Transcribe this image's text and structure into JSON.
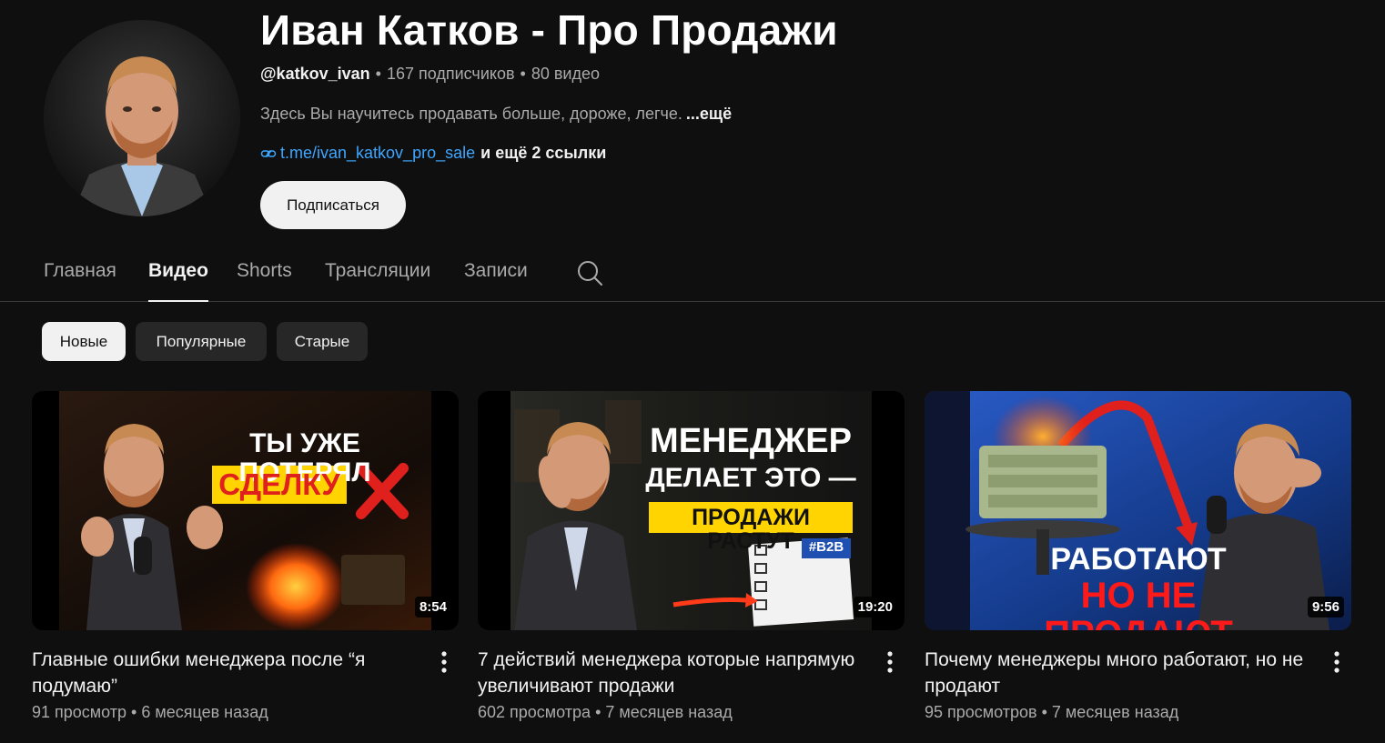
{
  "channel": {
    "name": "Иван Катков - Про Продажи",
    "handle": "@katkov_ivan",
    "subscribers": "167 подписчиков",
    "videos_count": "80 видео",
    "separator": "•",
    "description": "Здесь Вы научитесь продавать больше, дороже, легче.",
    "description_more": "...ещё",
    "link": "t.me/ivan_katkov_pro_sale",
    "more_links": "и ещё 2 ссылки",
    "subscribe_label": "Подписаться"
  },
  "tabs": [
    {
      "label": "Главная",
      "active": false
    },
    {
      "label": "Видео",
      "active": true
    },
    {
      "label": "Shorts",
      "active": false
    },
    {
      "label": "Трансляции",
      "active": false
    },
    {
      "label": "Записи",
      "active": false
    }
  ],
  "chips": [
    {
      "label": "Новые",
      "active": true
    },
    {
      "label": "Популярные",
      "active": false
    },
    {
      "label": "Старые",
      "active": false
    }
  ],
  "videos": [
    {
      "title": "Главные ошибки менеджера после “я подумаю”",
      "views": "91 просмотр",
      "age": "6 месяцев назад",
      "duration": "8:54",
      "thumb_line1": "ТЫ УЖЕ ПОТЕРЯЛ",
      "thumb_line2": "СДЕЛКУ"
    },
    {
      "title": "7 действий менеджера которые напрямую увеличивают продажи",
      "views": "602 просмотра",
      "age": "7 месяцев назад",
      "duration": "19:20",
      "thumb_line1": "МЕНЕДЖЕР",
      "thumb_line2": "ДЕЛАЕТ ЭТО —",
      "thumb_line3": "ПРОДАЖИ РАСТУТ",
      "thumb_tag": "#B2B"
    },
    {
      "title": "Почему менеджеры много работают, но не продают",
      "views": "95 просмотров",
      "age": "7 месяцев назад",
      "duration": "9:56",
      "thumb_line1": "РАБОТАЮТ",
      "thumb_line2": "НО НЕ ПРОДАЮТ"
    }
  ],
  "icons": {
    "link": "link-icon",
    "search": "search-icon",
    "more": "more-vert-icon"
  },
  "colors": {
    "background": "#0f0f0f",
    "link": "#3ea6ff",
    "text_secondary": "#aaaaaa"
  }
}
